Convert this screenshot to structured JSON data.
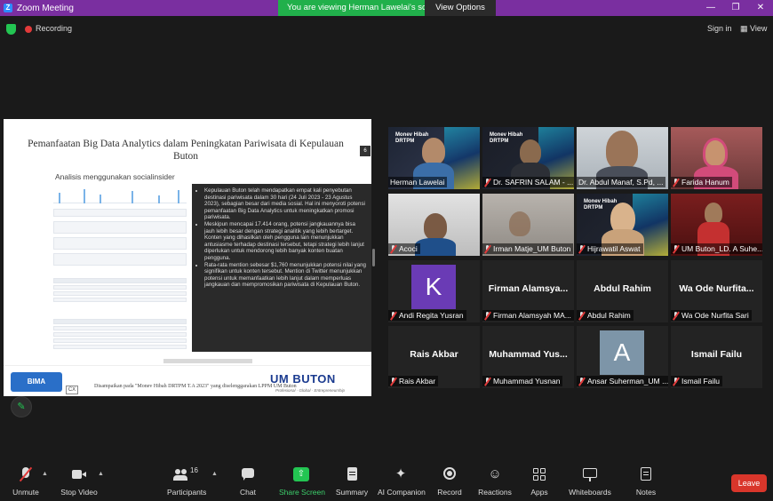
{
  "window": {
    "title": "Zoom Meeting",
    "logo": "Z"
  },
  "banner": {
    "viewing": "You are viewing Herman Lawelai's screen",
    "view_options": "View Options"
  },
  "status": {
    "recording": "Recording",
    "sign_in": "Sign in",
    "view": "View"
  },
  "slide": {
    "title": "Pemanfaatan Big Data Analytics dalam Peningkatan Pariwisata di Kepulauan Buton",
    "page_badge": "6",
    "subtitle": "Analisis menggunakan socialinsider",
    "bullets": [
      "Kepulauan Buton telah mendapatkan empat kali penyebutan destinasi pariwisata dalam 30 hari (24 Juli 2023 - 23 Agustus 2023), sebagian besar dari media sosial. Hal ini menyoroti potensi pemanfaatan Big Data Analytics untuk meningkatkan promosi pariwisata.",
      "Meskipun mencapai 17.414 orang, potensi jangkauannya bisa jauh lebih besar dengan strategi analitik yang lebih bertarget. Konten yang dihasilkan oleh pengguna lain menunjukkan antusiasme terhadap destinasi tersebut, tetapi strategi lebih lanjut diperlukan untuk mendorong lebih banyak konten buatan pengguna.",
      "Rata-rata mention sebesar $1,760 menunjukkan potensi nilai yang signifikan untuk konten tersebut. Mention di Twitter menunjukkan potensi untuk memanfaatkan lebih lanjut dalam memperluas jangkauan dan mempromosikan pariwisata di Kepulauan Buton."
    ],
    "footer_note": "Disampaikan pada \"Monev Hibah DRTPM T.A 2023\" yang diselenggarakan LPPM UM Buton",
    "logo_left": "BIMA",
    "cx": "CX",
    "logo_right": "UM BUTON",
    "logo_right_sub": "Profesional · Global · Entrepreneurship"
  },
  "participants": [
    {
      "name": "Herman Lawelai",
      "type": "video",
      "speaking": true,
      "muted": false,
      "overlay": "Monev Hibah DRTPM"
    },
    {
      "name": "Dr. SAFRIN SALAM - ...",
      "type": "video",
      "muted": true,
      "overlay": "Monev Hibah DRTPM"
    },
    {
      "name": "Dr. Abdul Manaf, S.Pd, ...",
      "type": "video",
      "muted": true
    },
    {
      "name": "Farida Hanum",
      "type": "video",
      "muted": true
    },
    {
      "name": "Acoci",
      "type": "video",
      "muted": true
    },
    {
      "name": "Irman Matje_UM Buton",
      "type": "video",
      "muted": true
    },
    {
      "name": "Hijrawatil Aswat",
      "type": "video",
      "muted": true,
      "overlay": "Monev Hibah DRTPM"
    },
    {
      "name": "UM Buton_LD. A Suhe...",
      "type": "video",
      "muted": true
    },
    {
      "name": "Andi Regita Yusran",
      "type": "avatar",
      "avatar": "K",
      "muted": true
    },
    {
      "name": "Firman Alamsyah MA...",
      "type": "name",
      "display": "Firman Alamsya...",
      "muted": true
    },
    {
      "name": "Abdul Rahim",
      "type": "name",
      "display": "Abdul Rahim",
      "muted": true
    },
    {
      "name": "Wa Ode Nurfita Sari",
      "type": "name",
      "display": "Wa Ode Nurfita...",
      "muted": true
    },
    {
      "name": "Rais Akbar",
      "type": "name",
      "display": "Rais Akbar",
      "muted": true
    },
    {
      "name": "Muhammad Yusnan",
      "type": "name",
      "display": "Muhammad Yus...",
      "muted": true
    },
    {
      "name": "Ansar Suherman_UM ...",
      "type": "avatar",
      "avatar": "A",
      "muted": true
    },
    {
      "name": "Ismail Failu",
      "type": "name",
      "display": "Ismail Failu",
      "muted": true
    }
  ],
  "toolbar": {
    "unmute": "Unmute",
    "stop_video": "Stop Video",
    "participants": "Participants",
    "participants_count": "16",
    "chat": "Chat",
    "share_screen": "Share Screen",
    "summary": "Summary",
    "ai_companion": "AI Companion",
    "record": "Record",
    "reactions": "Reactions",
    "apps": "Apps",
    "whiteboards": "Whiteboards",
    "notes": "Notes",
    "leave": "Leave"
  },
  "colors": {
    "title_bar": "#7a2fa0",
    "banner": "#21b04b",
    "leave": "#d9362b",
    "speaking": "#f1e53a"
  }
}
